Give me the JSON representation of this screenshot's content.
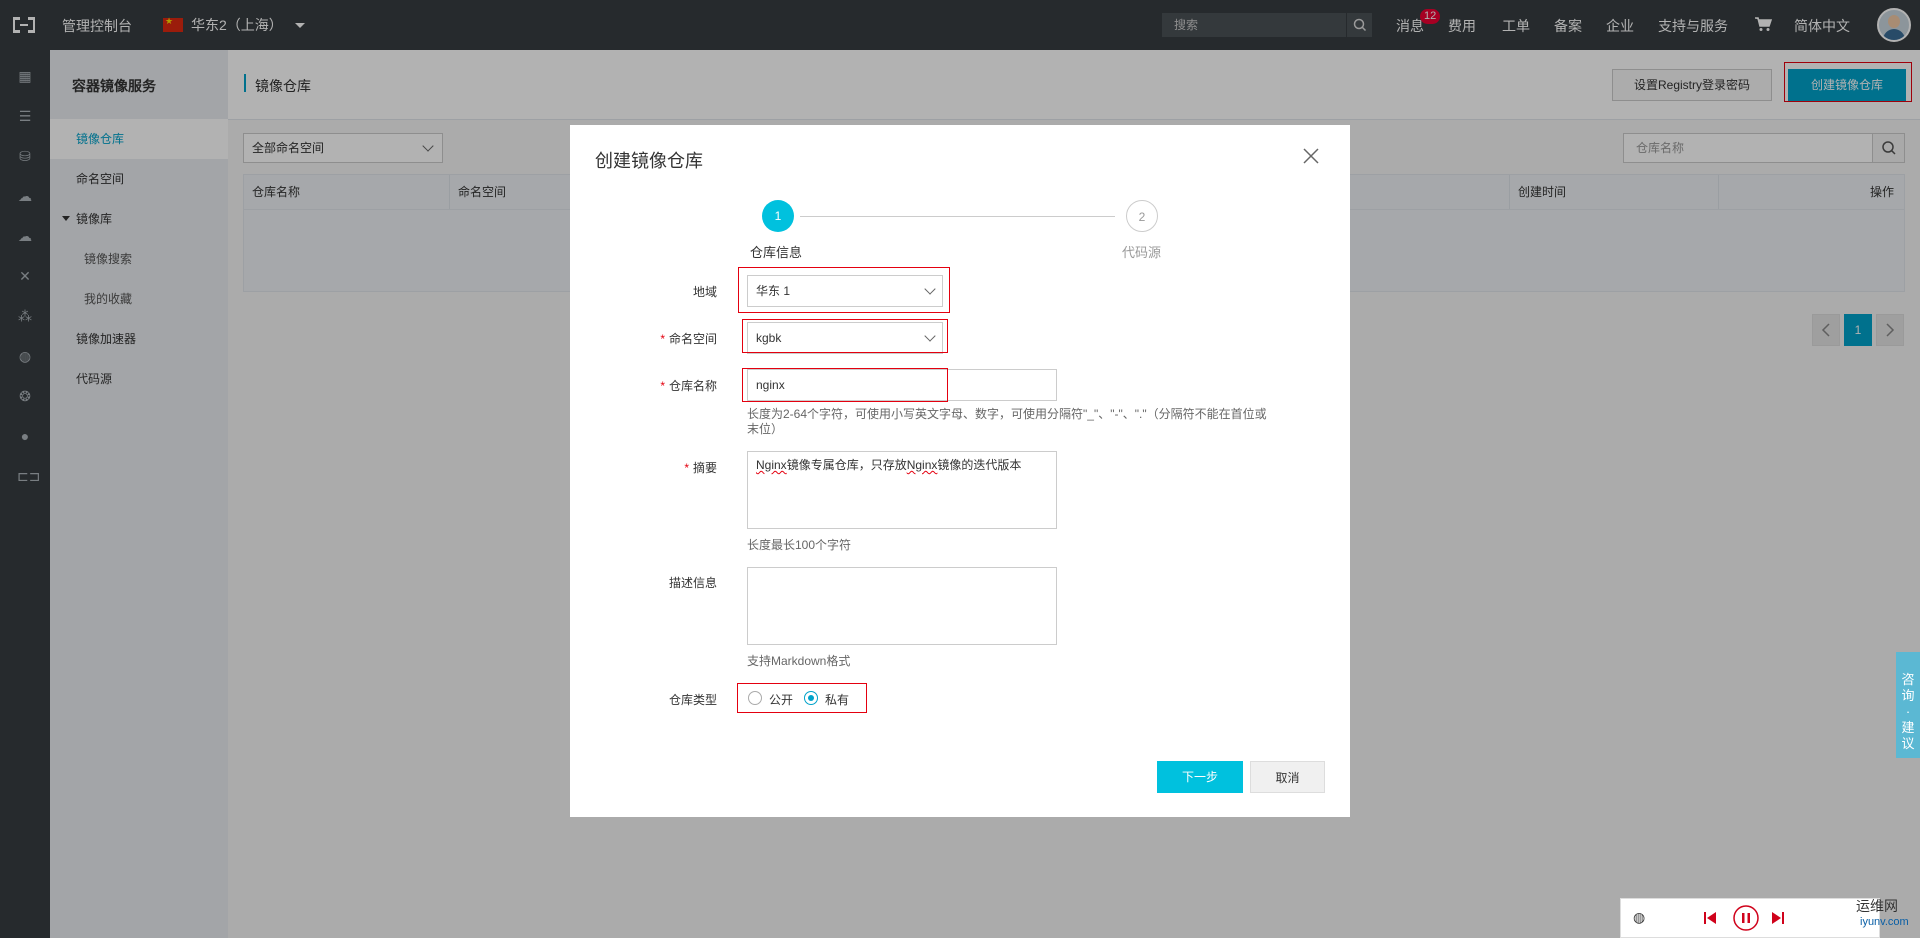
{
  "topbar": {
    "console": "管理控制台",
    "region": "华东2（上海）",
    "search_placeholder": "搜索",
    "badge": "12",
    "nav": [
      "消息",
      "费用",
      "工单",
      "备案",
      "企业",
      "支持与服务",
      "简体中文"
    ]
  },
  "sidebar": {
    "title": "容器镜像服务",
    "items": [
      "镜像仓库",
      "命名空间",
      "镜像库",
      "镜像搜索",
      "我的收藏",
      "镜像加速器",
      "代码源"
    ]
  },
  "main": {
    "title": "镜像仓库",
    "set_password_button": "设置Registry登录密码",
    "create_button": "创建镜像仓库",
    "namespace_filter": "全部命名空间",
    "search_placeholder": "仓库名称",
    "columns": [
      "仓库名称",
      "命名空间",
      "创建时间",
      "操作"
    ],
    "page": "1"
  },
  "modal": {
    "title": "创建镜像仓库",
    "steps": [
      {
        "num": "1",
        "label": "仓库信息"
      },
      {
        "num": "2",
        "label": "代码源"
      }
    ],
    "region_label": "地域",
    "region_value": "华东 1",
    "namespace_label": "命名空间",
    "namespace_value": "kgbk",
    "repo_name_label": "仓库名称",
    "repo_name_value": "nginx",
    "repo_name_hint": "长度为2-64个字符，可使用小写英文字母、数字，可使用分隔符\"_\"、\"-\"、\".\"（分隔符不能在首位或末位）",
    "summary_label": "摘要",
    "summary_prefix": "Nginx",
    "summary_mid": "镜像专属仓库，只存放",
    "summary_word2": "Nginx",
    "summary_suffix": "镜像的迭代版本",
    "summary_hint": "长度最长100个字符",
    "desc_label": "描述信息",
    "desc_hint": "支持Markdown格式",
    "type_label": "仓库类型",
    "type_public": "公开",
    "type_private": "私有",
    "next_button": "下一步",
    "cancel_button": "取消"
  },
  "float": {
    "consult": [
      "咨",
      "询",
      "·",
      "建",
      "议"
    ]
  },
  "watermark": "运维网",
  "watermark_sub": "iyunv.com"
}
